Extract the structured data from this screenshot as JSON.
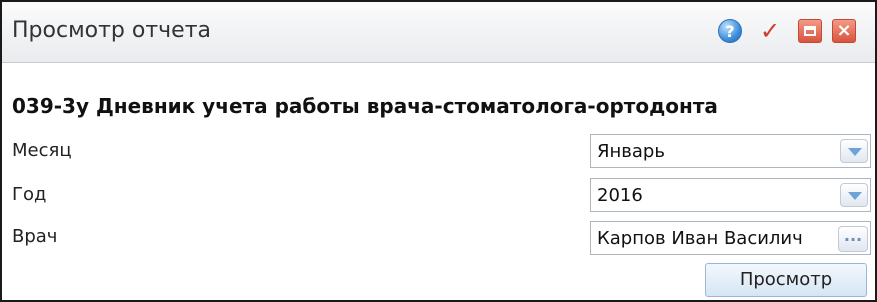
{
  "window": {
    "title": "Просмотр отчета"
  },
  "report": {
    "title": "039-3у Дневник учета работы врача-стоматолога-ортодонта"
  },
  "fields": {
    "month": {
      "label": "Месяц",
      "value": "Январь"
    },
    "year": {
      "label": "Год",
      "value": "2016"
    },
    "doctor": {
      "label": "Врач",
      "value": "Карпов Иван Василич"
    }
  },
  "buttons": {
    "view": "Просмотр",
    "help_glyph": "?",
    "ok_glyph": "✓",
    "close_glyph": "×",
    "lookup_glyph": "..."
  },
  "icons": {
    "help": "help-icon",
    "ok": "check-icon",
    "minimize": "minimize-icon",
    "close": "close-icon"
  },
  "colors": {
    "accent": "#3f8fdc",
    "danger": "#d9533d"
  }
}
